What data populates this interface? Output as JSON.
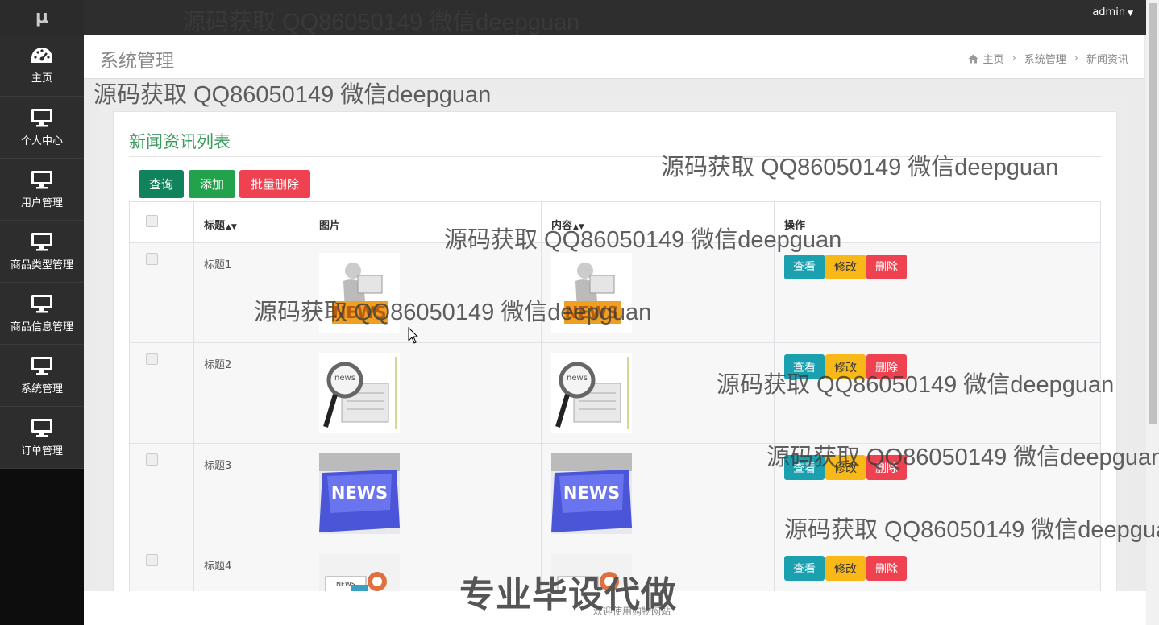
{
  "sidebar": {
    "logo": "μ",
    "items": [
      {
        "label": "主页",
        "icon": "dashboard-icon"
      },
      {
        "label": "个人中心",
        "icon": "monitor-icon"
      },
      {
        "label": "用户管理",
        "icon": "monitor-icon"
      },
      {
        "label": "商品类型管理",
        "icon": "monitor-icon"
      },
      {
        "label": "商品信息管理",
        "icon": "monitor-icon"
      },
      {
        "label": "系统管理",
        "icon": "monitor-icon"
      },
      {
        "label": "订单管理",
        "icon": "monitor-icon"
      }
    ]
  },
  "topbar": {
    "user": "admin"
  },
  "header": {
    "title": "系统管理",
    "breadcrumb": [
      "主页",
      "系统管理",
      "新闻资讯"
    ]
  },
  "panel": {
    "title": "新闻资讯列表",
    "buttons": {
      "query": "查询",
      "add": "添加",
      "batch_delete": "批量删除"
    }
  },
  "table": {
    "columns": [
      "标题",
      "图片",
      "内容",
      "操作"
    ],
    "rows": [
      {
        "title": "标题1",
        "image": "news-figure-image"
      },
      {
        "title": "标题2",
        "image": "magnifier-newspaper-image"
      },
      {
        "title": "标题3",
        "image": "news-key-image"
      },
      {
        "title": "标题4",
        "image": "news-envelope-image"
      }
    ],
    "actions": {
      "view": "查看",
      "edit": "修改",
      "delete": "删除"
    }
  },
  "footer": {
    "text": "欢迎使用购物网站"
  },
  "watermarks": {
    "text": "源码获取 QQ86050149 微信deepguan",
    "big": "专业毕设代做"
  },
  "colors": {
    "sidebar": "#2d2d2d",
    "topbar": "#2e2e2e",
    "title_green": "#3c9a5f",
    "query": "#11825c",
    "add": "#22a24b",
    "delete": "#ef4250",
    "view": "#1ba0b0",
    "edit": "#f7b818"
  }
}
